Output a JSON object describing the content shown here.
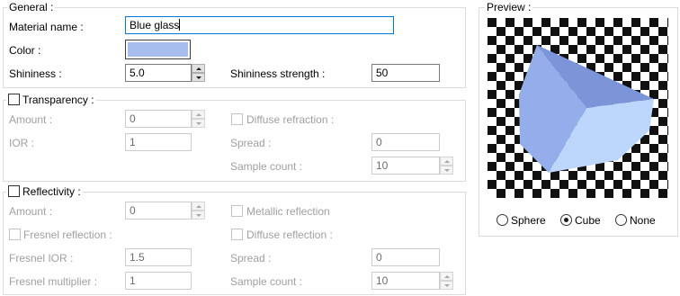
{
  "general": {
    "legend": "General :",
    "material_name_label": "Material name :",
    "material_name_value": "Blue glass",
    "color_label": "Color :",
    "color_value": "#a7bdf0",
    "shininess_label": "Shininess :",
    "shininess_value": "5.0",
    "shininess_strength_label": "Shininess strength :",
    "shininess_strength_value": "50"
  },
  "transparency": {
    "legend": "Transparency :",
    "checked": false,
    "amount_label": "Amount :",
    "amount_value": "0",
    "ior_label": "IOR :",
    "ior_value": "1",
    "diffuse_refraction_label": "Diffuse refraction :",
    "spread_label": "Spread :",
    "spread_value": "0",
    "sample_count_label": "Sample count :",
    "sample_count_value": "10"
  },
  "reflectivity": {
    "legend": "Reflectivity :",
    "checked": false,
    "amount_label": "Amount :",
    "amount_value": "0",
    "metallic_reflection_label": "Metallic reflection",
    "fresnel_reflection_label": "Fresnel reflection :",
    "diffuse_reflection_label": "Diffuse reflection :",
    "fresnel_ior_label": "Fresnel IOR :",
    "fresnel_ior_value": "1.5",
    "spread_label": "Spread :",
    "spread_value": "0",
    "fresnel_multiplier_label": "Fresnel multiplier :",
    "fresnel_multiplier_value": "1",
    "sample_count_label": "Sample count :",
    "sample_count_value": "10"
  },
  "preview": {
    "legend": "Preview :",
    "shape_options": [
      "Sphere",
      "Cube",
      "None"
    ],
    "selected_shape": "Cube",
    "cube_colors": {
      "top": "#7b95d8",
      "left": "#93aeea",
      "right": "#bcd6fc"
    }
  }
}
